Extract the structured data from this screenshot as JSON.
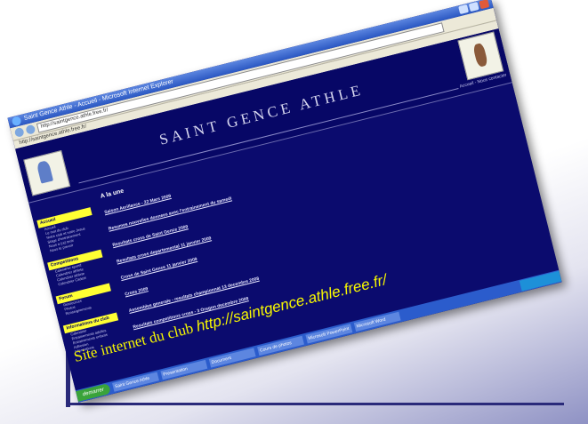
{
  "browser": {
    "window_title": "Saint Gence Athle - Accueil - Microsoft Internet Explorer",
    "address": "http://saintgence.athle.free.fr/",
    "favorites": "http://saintgence.athle.free.fr/"
  },
  "site": {
    "title": "SAINT GENCE ATHLE",
    "header_links": "Accueil - Nous contacter"
  },
  "sidebar": {
    "sections": [
      {
        "title": "Accueil",
        "items": [
          "Accueil",
          "Le mot du club",
          "Notre club et notre Jesus",
          "Stage d'entrainement",
          "Nous a (re) tenir",
          "Nous te prevoir"
        ]
      },
      {
        "title": "Competitions",
        "items": [
          "Calendrier sportif",
          "Calendrier athlete",
          "Calendrier athlete",
          "Calendrier Cadets"
        ]
      },
      {
        "title": "Forum",
        "items": [
          "Ressources",
          "Photos",
          "Renseignements"
        ]
      },
      {
        "title": "Informations du club",
        "items": [
          "Calendrier",
          "Entrainements adultes",
          "Entrainements enfants",
          "Adhesion",
          "Informations"
        ]
      }
    ]
  },
  "content": {
    "heading": "A la une",
    "news": [
      "Saison Aerillance - 22 Mars 2009",
      "Resumes nouvelles donnees avec l'entrainement du samedi",
      "Resultats cross de Saint Gence 2009",
      "Resultats cross departemental 11 janvier 2009",
      "Cross de Saint Gence 11 janvier 2009",
      "Cross 2009",
      "Assemblee generale - resultats championnat 13 decembre 2008",
      "Resultats competitions cross - 3 Oregon decembre 2008"
    ]
  },
  "taskbar": {
    "start_label": "demarrer",
    "tasks": [
      "Saint Gence Athle",
      "Presentation",
      "Document",
      "Cours de photos",
      "Microsoft PowerPoint",
      "Microsoft Word"
    ]
  },
  "caption": {
    "label": "Site internet du club ",
    "url": "http://saintgence.athle.free.fr/"
  },
  "colors": {
    "page_bg": "#0b0b6e",
    "nav_head": "#ffff33",
    "caption_text": "#f7f700",
    "slide_rule": "#2a2a7a"
  }
}
